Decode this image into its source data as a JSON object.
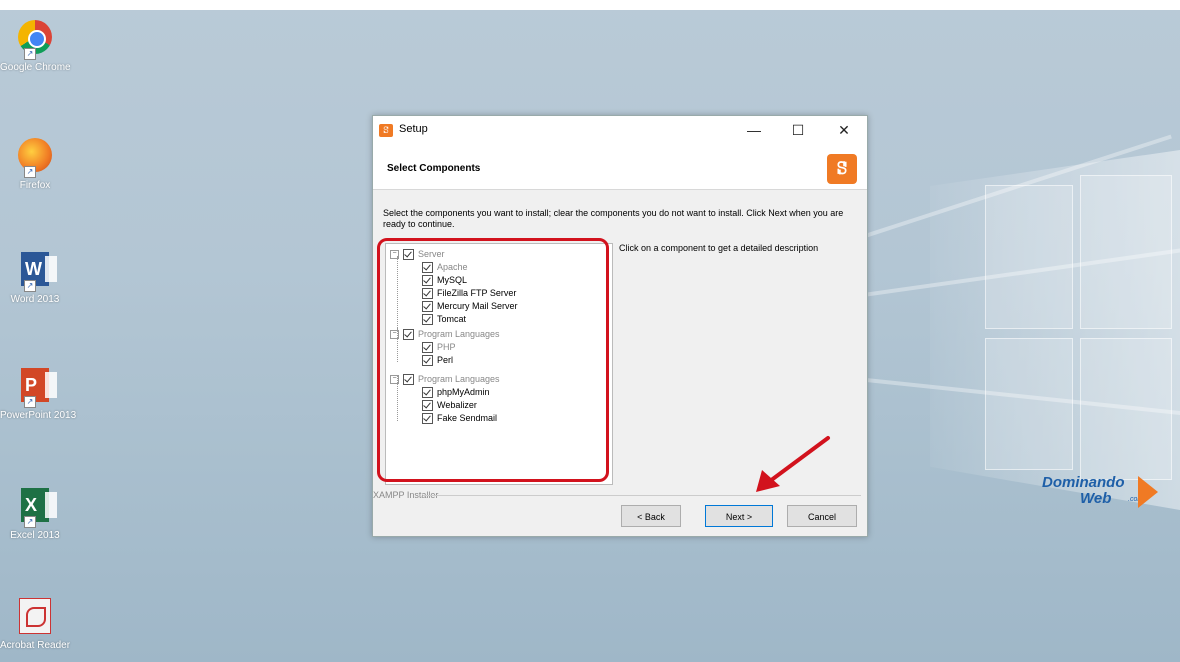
{
  "desktop": {
    "icons": [
      {
        "label": "Google Chrome",
        "icon": "chrome-icon"
      },
      {
        "label": "Firefox",
        "icon": "firefox-icon"
      },
      {
        "label": "Word 2013",
        "icon": "word-icon"
      },
      {
        "label": "PowerPoint 2013",
        "icon": "powerpoint-icon"
      },
      {
        "label": "Excel 2013",
        "icon": "excel-icon"
      },
      {
        "label": "Acrobat Reader",
        "icon": "acrobat-icon"
      }
    ]
  },
  "dialog": {
    "title": "Setup",
    "header_title": "Select Components",
    "logo": "ꗟ",
    "instructions": "Select the components you want to install; clear the components you do not want to install. Click Next when you are ready to continue.",
    "description_hint": "Click on a component to get a detailed description",
    "footer_label": "XAMPP Installer",
    "buttons": {
      "back": "< Back",
      "next": "Next >",
      "cancel": "Cancel"
    },
    "window_controls": {
      "minimize": "—",
      "maximize": "☐",
      "close": "✕"
    },
    "tree": [
      {
        "label": "Server",
        "type": "group",
        "checked": true,
        "children": [
          {
            "label": "Apache",
            "dim": true
          },
          {
            "label": "MySQL",
            "dim": false
          },
          {
            "label": "FileZilla FTP Server",
            "dim": false
          },
          {
            "label": "Mercury Mail Server",
            "dim": false
          },
          {
            "label": "Tomcat",
            "dim": false
          }
        ]
      },
      {
        "label": "Program Languages",
        "type": "group",
        "checked": true,
        "children": [
          {
            "label": "PHP",
            "dim": true
          },
          {
            "label": "Perl",
            "dim": false
          }
        ]
      },
      {
        "label": "Program Languages",
        "type": "group",
        "checked": true,
        "children": [
          {
            "label": "phpMyAdmin",
            "dim": false
          },
          {
            "label": "Webalizer",
            "dim": false
          },
          {
            "label": "Fake Sendmail",
            "dim": false
          }
        ]
      }
    ]
  },
  "brand": {
    "line1": "Dominando",
    "line2": "Web",
    "line3": ".com"
  },
  "colors": {
    "highlight": "#d2121d",
    "xampp_orange": "#f07a24",
    "brand_blue": "#1e5fa8"
  }
}
